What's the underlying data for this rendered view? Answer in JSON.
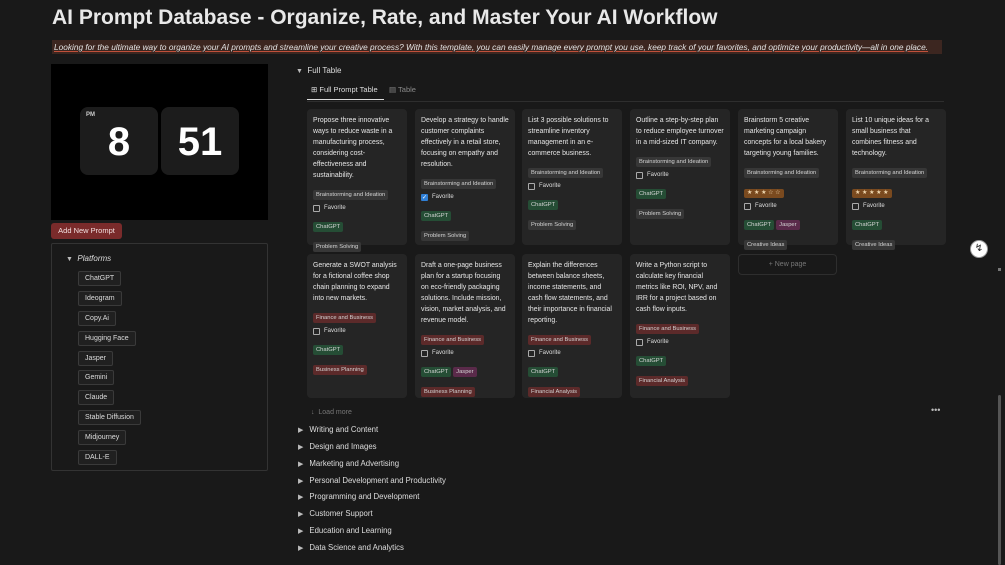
{
  "page": {
    "title": "AI Prompt Database - Organize, Rate, and Master Your AI Workflow",
    "subtitle": "Looking for the ultimate way to organize your AI prompts and streamline your creative process? With this template, you can easily manage every prompt you use, keep track of your favorites, and optimize your productivity—all in one place."
  },
  "clock": {
    "ampm": "PM",
    "hour": "8",
    "minute": "51"
  },
  "sidebar": {
    "add_button": "Add New Prompt",
    "platforms_title": "Platforms",
    "platforms": [
      "ChatGPT",
      "Ideogram",
      "Copy.Ai",
      "Hugging Face",
      "Jasper",
      "Gemini",
      "Claude",
      "Stable Diffusion",
      "Midjourney",
      "DALL-E"
    ]
  },
  "view": {
    "section_title": "Full Table",
    "tabs": [
      "Full Prompt Table",
      "Table"
    ],
    "new_page": "+ New page",
    "load_more": "Load more",
    "more_menu": "•••"
  },
  "colors": {
    "category_brainstorm": "#373737",
    "category_finance": "#5c2a2a",
    "platform_chatgpt": "#254d35",
    "platform_jasper": "#5a2a4a",
    "use_problem": "#373737",
    "use_business": "#5c2a2a",
    "use_creative": "#373737",
    "use_financial": "#5c2a2a",
    "stars_bg": "#7a4a1f"
  },
  "cards": [
    {
      "text": "Propose three innovative ways to reduce waste in a manufacturing process, considering cost-effectiveness and sustainability.",
      "category": "Brainstorming and Ideation",
      "favorite_label": "Favorite",
      "favorite": false,
      "platforms": [
        "ChatGPT"
      ],
      "use": "Problem Solving"
    },
    {
      "text": "Develop a strategy to handle customer complaints effectively in a retail store, focusing on empathy and resolution.",
      "category": "Brainstorming and Ideation",
      "favorite_label": "Favorite",
      "favorite": true,
      "platforms": [
        "ChatGPT"
      ],
      "use": "Problem Solving"
    },
    {
      "text": "List 3 possible solutions to streamline inventory management in an e-commerce business.",
      "category": "Brainstorming and Ideation",
      "favorite_label": "Favorite",
      "favorite": false,
      "platforms": [
        "ChatGPT"
      ],
      "use": "Problem Solving"
    },
    {
      "text": "Outline a step-by-step plan to reduce employee turnover in a mid-sized IT company.",
      "category": "Brainstorming and Ideation",
      "favorite_label": "Favorite",
      "favorite": false,
      "platforms": [
        "ChatGPT"
      ],
      "use": "Problem Solving"
    },
    {
      "text": "Brainstorm 5 creative marketing campaign concepts for a local bakery targeting young families.",
      "category": "Brainstorming and Ideation",
      "stars": "★ ★ ★ ☆ ☆",
      "rating": 3,
      "favorite_label": "Favorite",
      "favorite": false,
      "platforms": [
        "ChatGPT",
        "Jasper"
      ],
      "use": "Creative Ideas"
    },
    {
      "text": "List 10 unique ideas for a small business that combines fitness and technology.",
      "category": "Brainstorming and Ideation",
      "stars": "★ ★ ★ ★ ★",
      "rating": 5,
      "favorite_label": "Favorite",
      "favorite": false,
      "platforms": [
        "ChatGPT"
      ],
      "use": "Creative Ideas"
    },
    {
      "text": "Generate a SWOT analysis for a fictional coffee shop chain planning to expand into new markets.",
      "category": "Finance and Business",
      "favorite_label": "Favorite",
      "favorite": false,
      "platforms": [
        "ChatGPT"
      ],
      "use": "Business Planning"
    },
    {
      "text": "Draft a one-page business plan for a startup focusing on eco-friendly packaging solutions. Include mission, vision, market analysis, and revenue model.",
      "category": "Finance and Business",
      "favorite_label": "Favorite",
      "favorite": false,
      "platforms": [
        "ChatGPT",
        "Jasper"
      ],
      "use": "Business Planning"
    },
    {
      "text": "Explain the differences between balance sheets, income statements, and cash flow statements, and their importance in financial reporting.",
      "category": "Finance and Business",
      "favorite_label": "Favorite",
      "favorite": false,
      "platforms": [
        "ChatGPT"
      ],
      "use": "Financial Analysis"
    },
    {
      "text": "Write a Python script to calculate key financial metrics like ROI, NPV, and IRR for a project based on cash flow inputs.",
      "category": "Finance and Business",
      "favorite_label": "Favorite",
      "favorite": false,
      "platforms": [
        "ChatGPT"
      ],
      "use": "Financial Analysis"
    }
  ],
  "groups": [
    "Writing and Content",
    "Design and Images",
    "Marketing and Advertising",
    "Personal Development and Productivity",
    "Programming and Development",
    "Customer Support",
    "Education and Learning",
    "Data Science and Analytics"
  ]
}
